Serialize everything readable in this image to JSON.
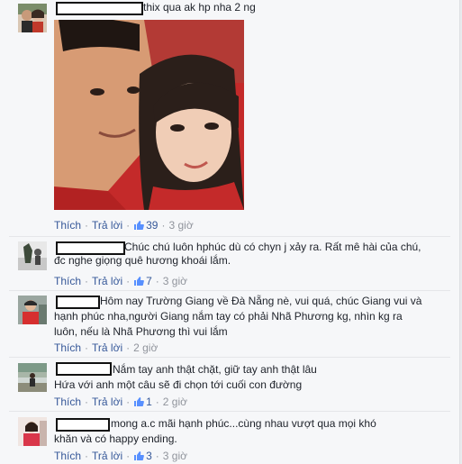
{
  "comments": [
    {
      "text": "thix qua ak hp nha 2 ng",
      "actions": {
        "like": "Thích",
        "reply": "Trả lời",
        "likes": "39",
        "time": "3 giờ"
      }
    },
    {
      "text_lines": [
        "Chúc chú luôn hphúc dù có chyn j xảy ra. Rất mê hài của chú,",
        "đc nghe giọng quê hương khoái lắm."
      ],
      "actions": {
        "like": "Thích",
        "reply": "Trả lời",
        "likes": "7",
        "time": "3 giờ"
      }
    },
    {
      "text_lines": [
        "Hôm nay Trường Giang về Đà Nẵng nè, vui quá, chúc Giang vui và",
        "hạnh phúc nha,người Giang nắm tay có phải Nhã Phương kg, nhìn kg ra",
        "luôn, nếu là Nhã Phương thì vui lắm"
      ],
      "actions": {
        "like": "Thích",
        "reply": "Trả lời",
        "time": "2 giờ"
      }
    },
    {
      "text_lines": [
        "Nắm tay anh thật chặt, giữ tay anh thật lâu",
        "Hứa với anh một câu sẽ đi chọn tới cuối con đường"
      ],
      "actions": {
        "like": "Thích",
        "reply": "Trả lời",
        "likes": "1",
        "time": "2 giờ"
      }
    },
    {
      "text_lines": [
        "mong a.c mãi hạnh phúc...cùng nhau vượt qua mọi khó",
        "khăn và có happy ending."
      ],
      "actions": {
        "like": "Thích",
        "reply": "Trả lời",
        "likes": "3",
        "time": "3 giờ"
      }
    }
  ],
  "colors": {
    "link": "#365899",
    "meta": "#90949c",
    "background": "#f6f7f9"
  }
}
